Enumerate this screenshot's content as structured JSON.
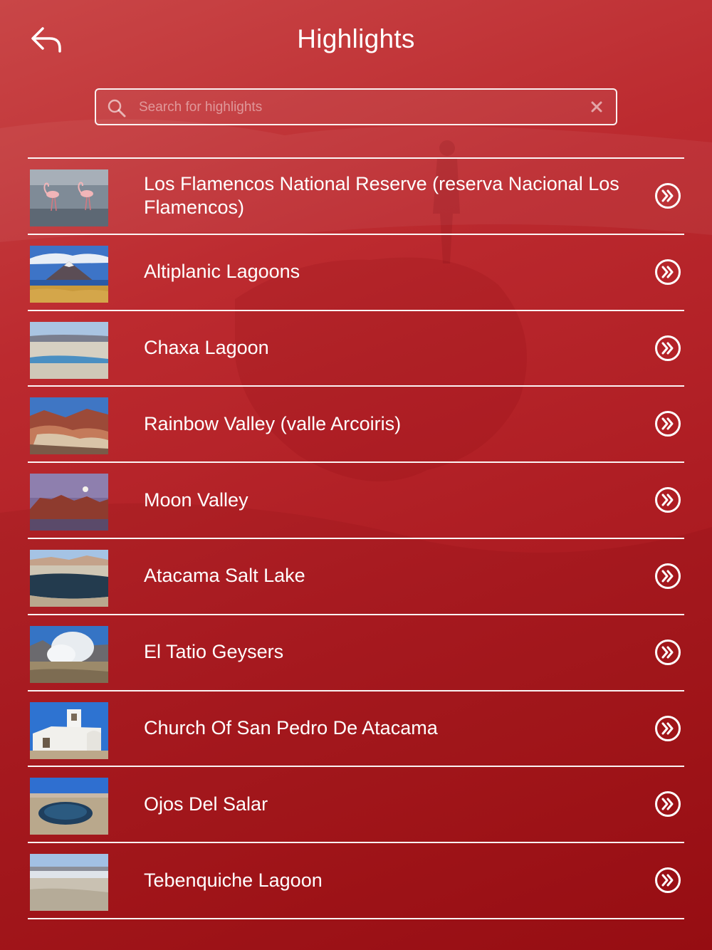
{
  "header": {
    "title": "Highlights"
  },
  "search": {
    "placeholder": "Search for highlights",
    "value": ""
  },
  "highlights": [
    {
      "name": "Los Flamencos National Reserve (reserva Nacional Los Flamencos)",
      "thumbnail": "flamingos-photo"
    },
    {
      "name": "Altiplanic Lagoons",
      "thumbnail": "volcano-lagoon-photo"
    },
    {
      "name": "Chaxa Lagoon",
      "thumbnail": "salt-flat-lagoon-photo"
    },
    {
      "name": "Rainbow Valley (valle Arcoiris)",
      "thumbnail": "red-rock-valley-photo"
    },
    {
      "name": "Moon Valley",
      "thumbnail": "moonrise-valley-photo"
    },
    {
      "name": "Atacama Salt Lake",
      "thumbnail": "salt-lake-photo"
    },
    {
      "name": "El Tatio Geysers",
      "thumbnail": "geysers-photo"
    },
    {
      "name": "Church Of San Pedro De Atacama",
      "thumbnail": "white-church-photo"
    },
    {
      "name": "Ojos Del Salar",
      "thumbnail": "desert-pool-photo"
    },
    {
      "name": "Tebenquiche Lagoon",
      "thumbnail": "salt-plain-photo"
    }
  ],
  "icons": {
    "back": "back-arrow-icon",
    "search": "search-icon",
    "clear": "clear-icon",
    "row_action": "double-chevron-circle-icon"
  },
  "colors": {
    "background_top": "#c94647",
    "background_bottom": "#9c0f14",
    "foreground": "#ffffff"
  }
}
